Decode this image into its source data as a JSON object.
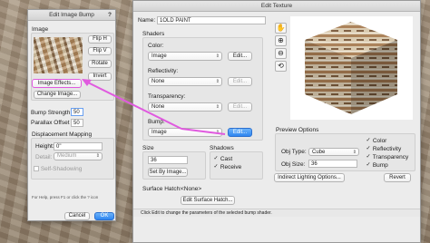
{
  "edit_texture": {
    "title": "Edit Texture",
    "name_label": "Name:",
    "name_value": "1OLD PAINT",
    "shaders_label": "Shaders",
    "color_label": "Color:",
    "color_value": "Image",
    "color_edit": "Edit...",
    "reflectivity_label": "Reflectivity:",
    "reflectivity_value": "None",
    "reflectivity_edit": "Edit...",
    "transparency_label": "Transparency:",
    "transparency_value": "None",
    "transparency_edit": "Edit...",
    "bump_label": "Bump:",
    "bump_value": "Image",
    "bump_edit": "Edit...",
    "size_label": "Size",
    "size_value": "36",
    "set_by_image": "Set By Image...",
    "shadows_label": "Shadows",
    "cast_label": "Cast",
    "receive_label": "Receive",
    "surface_hatch_label": "Surface Hatch:",
    "surface_hatch_value": "<None>",
    "edit_surface_hatch": "Edit Surface Hatch...",
    "preview_options_label": "Preview Options",
    "obj_type_label": "Obj Type:",
    "obj_type_value": "Cube",
    "obj_size_label": "Obj Size:",
    "obj_size_value": "36",
    "preview_color": "Color",
    "preview_reflectivity": "Reflectivity",
    "preview_transparency": "Transparency",
    "preview_bump": "Bump",
    "indirect_lighting": "Indirect Lighting Options...",
    "revert": "Revert",
    "status_text": "Click Edit to change the parameters of the selected bump shader."
  },
  "edit_image_bump": {
    "title": "Edit Image Bump",
    "help_mark": "?",
    "image_label": "Image",
    "flip_h": "Flip H",
    "flip_v": "Flip V",
    "rotate": "Rotate",
    "invert": "Invert",
    "image_effects": "Image Effects...",
    "change_image": "Change Image...",
    "bump_strength_label": "Bump Strength (%):",
    "bump_strength_value": "50",
    "parallax_label": "Parallax Offset (%)",
    "parallax_value": "50",
    "displacement_label": "Displacement Mapping",
    "height_label": "Height:",
    "height_value": "0\"",
    "detail_label": "Detail:",
    "detail_value": "Medium",
    "self_shadowing": "Self-Shadowing",
    "help_text": "For Help, press F1 or click the ? icon",
    "cancel": "Cancel",
    "ok": "OK"
  },
  "icons": [
    "hand-icon",
    "zoom-in-icon",
    "zoom-out-icon",
    "rotate-view-icon"
  ],
  "colors": {
    "highlight": "#e05adf",
    "accent": "#2f86f0"
  }
}
